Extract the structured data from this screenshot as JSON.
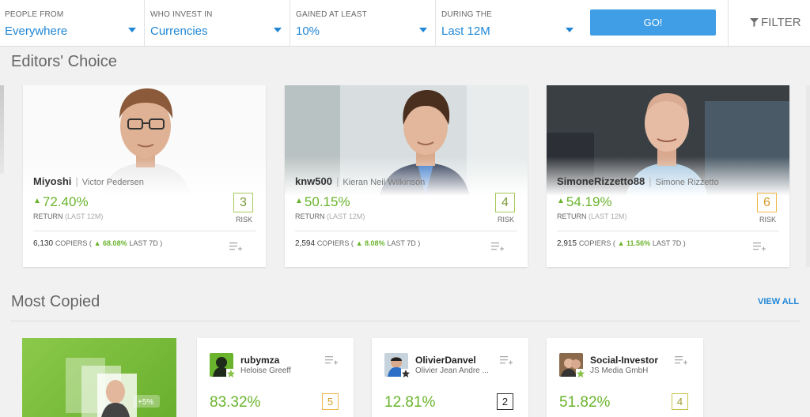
{
  "filters": [
    {
      "label": "PEOPLE FROM",
      "value": "Everywhere"
    },
    {
      "label": "WHO INVEST IN",
      "value": "Currencies"
    },
    {
      "label": "GAINED AT LEAST",
      "value": "10%"
    },
    {
      "label": "DURING THE",
      "value": "Last 12M"
    }
  ],
  "go_label": "GO!",
  "filter_label": "FILTER",
  "editors_title": "Editors' Choice",
  "most_copied_title": "Most Copied",
  "view_all": "VIEW ALL",
  "editors": [
    {
      "username": "Miyoshi",
      "fullname": "Victor Pedersen",
      "return": "72.40%",
      "return_label": "RETURN",
      "period": "(LAST 12M)",
      "risk": "3",
      "risk_label": "RISK",
      "copiers": "6,130",
      "copiers_label": "COPIERS (",
      "change": "68.08%",
      "change_period": "LAST 7D )"
    },
    {
      "username": "knw500",
      "fullname": "Kieran Neil Wilkinson",
      "return": "50.15%",
      "return_label": "RETURN",
      "period": "(LAST 12M)",
      "risk": "4",
      "risk_label": "RISK",
      "copiers": "2,594",
      "copiers_label": "COPIERS (",
      "change": "8.08%",
      "change_period": "LAST 7D )"
    },
    {
      "username": "SimoneRizzetto88",
      "fullname": "Simone Rizzetto",
      "return": "54.19%",
      "return_label": "RETURN",
      "period": "(LAST 12M)",
      "risk": "6",
      "risk_label": "RISK",
      "copiers": "2,915",
      "copiers_label": "COPIERS (",
      "change": "11.56%",
      "change_period": "LAST 7D )"
    }
  ],
  "most_copied": [
    {
      "username": "rubymza",
      "fullname": "Heloise Greeff",
      "return": "83.32%",
      "risk": "5"
    },
    {
      "username": "OlivierDanvel",
      "fullname": "Olivier Jean Andre ...",
      "return": "12.81%",
      "risk": "2"
    },
    {
      "username": "Social-Investor",
      "fullname": "JS Media GmbH",
      "return": "51.82%",
      "risk": "4"
    }
  ],
  "promo_text": "+5%",
  "colors": {
    "accent": "#1f86d6",
    "positive": "#6ab42d",
    "button": "#3f9ee5"
  }
}
